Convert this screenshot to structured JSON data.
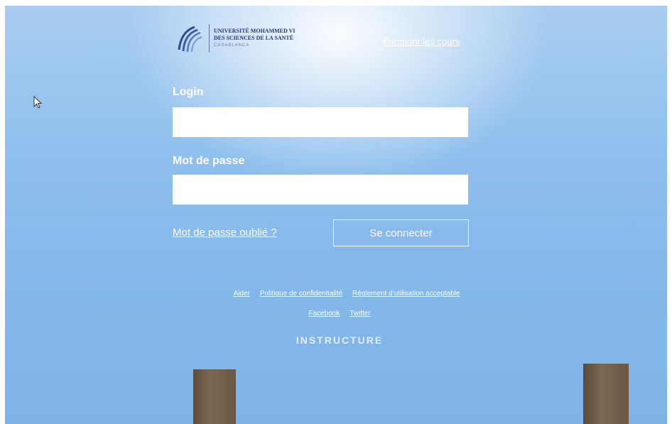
{
  "logo": {
    "line1": "UNIVERSITÉ MOHAMMED VI",
    "line2": "DES SCIENCES DE LA SANTÉ",
    "line3": "CASABLANCA"
  },
  "header": {
    "browse_courses": "Parcourir les cours"
  },
  "form": {
    "login_label": "Login",
    "login_value": "",
    "password_label": "Mot de passe",
    "password_value": "",
    "forgot_password": "Mot de passe oublié ?",
    "connect_button": "Se connecter"
  },
  "footer": {
    "links_row1": [
      "Aider",
      "Politique de confidentialité",
      "Règlement d'utilisation acceptable"
    ],
    "links_row2": [
      "Facebook",
      "Twitter"
    ],
    "brand": "INSTRUCTURE"
  },
  "colors": {
    "sky": "#8fc0ee",
    "text": "#ffffff",
    "logo_text": "#2a3570"
  }
}
